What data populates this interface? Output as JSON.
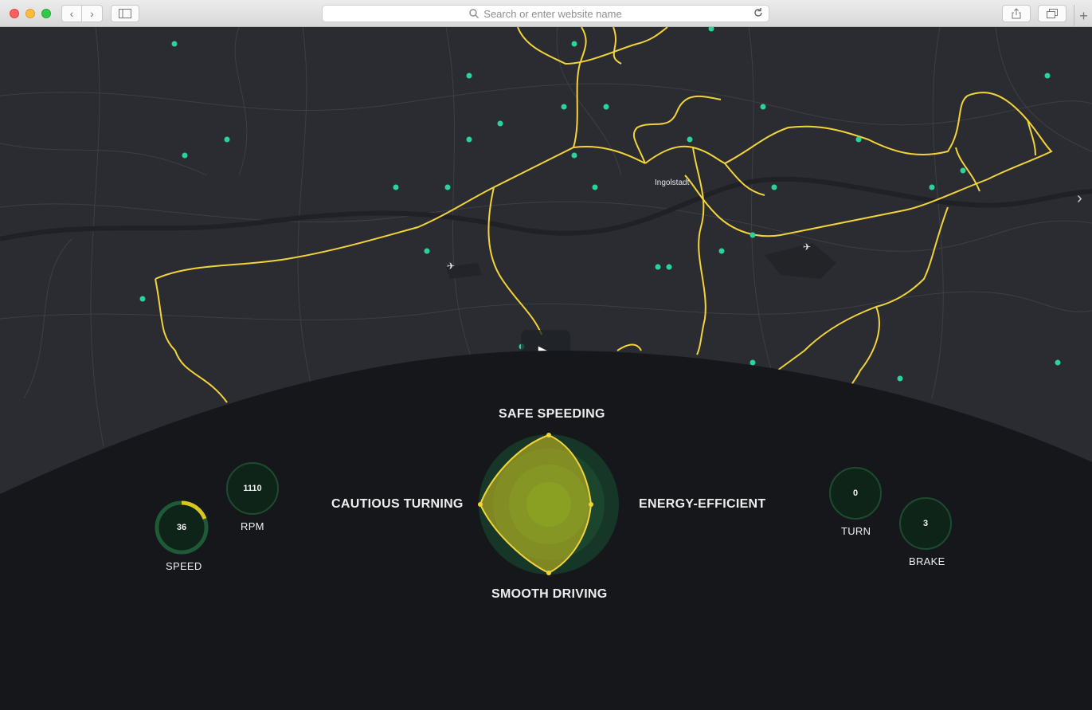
{
  "browser": {
    "url_placeholder": "Search or enter website name",
    "back_glyph": "‹",
    "forward_glyph": "›",
    "newtab_glyph": "+"
  },
  "map": {
    "city_label": "Ingolstadt",
    "play_glyph": "▶",
    "next_glyph": "›"
  },
  "radar": {
    "top": "SAFE SPEEDING",
    "left": "CAUTIOUS TURNING",
    "right": "ENERGY-EFFICIENT",
    "bottom": "SMOOTH DRIVING"
  },
  "gauges": {
    "speed": {
      "value": "36",
      "label": "SPEED",
      "fill_fraction": 0.2
    },
    "rpm": {
      "value": "1110",
      "label": "RPM"
    },
    "turn": {
      "value": "0",
      "label": "TURN"
    },
    "brake": {
      "value": "3",
      "label": "BRAKE"
    }
  },
  "colors": {
    "route": "#f2d43a",
    "marker": "#2bd39a",
    "dash_bg": "#15171b"
  }
}
